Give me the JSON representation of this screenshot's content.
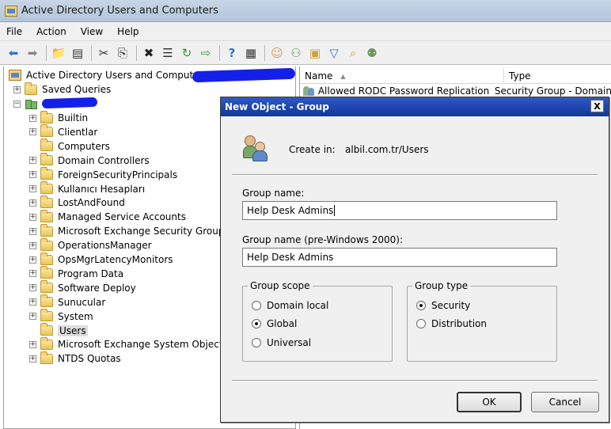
{
  "window": {
    "title": "Active Directory Users and Computers"
  },
  "menu": [
    "File",
    "Action",
    "View",
    "Help"
  ],
  "toolbar": {
    "icons": [
      "back-arrow-icon",
      "forward-arrow-icon",
      "up-folder-icon",
      "show-hide-console-tree-icon",
      "cut-icon",
      "copy-icon",
      "delete-icon",
      "properties-icon",
      "refresh-icon",
      "export-list-icon",
      "help-icon",
      "view-icon",
      "new-user-icon",
      "new-group-icon",
      "new-ou-icon",
      "filter-icon",
      "find-icon",
      "add-to-group-icon"
    ]
  },
  "tree": {
    "root": "Active Directory Users and Computers [",
    "saved_queries": "Saved Queries",
    "items": [
      {
        "label": "Builtin",
        "expandable": true
      },
      {
        "label": "Clientlar",
        "expandable": true
      },
      {
        "label": "Computers",
        "expandable": false
      },
      {
        "label": "Domain Controllers",
        "expandable": true
      },
      {
        "label": "ForeignSecurityPrincipals",
        "expandable": true
      },
      {
        "label": "Kullanıcı Hesapları",
        "expandable": true
      },
      {
        "label": "LostAndFound",
        "expandable": true
      },
      {
        "label": "Managed Service Accounts",
        "expandable": true
      },
      {
        "label": "Microsoft Exchange Security Groups",
        "expandable": true
      },
      {
        "label": "OperationsManager",
        "expandable": true
      },
      {
        "label": "OpsMgrLatencyMonitors",
        "expandable": true
      },
      {
        "label": "Program Data",
        "expandable": true
      },
      {
        "label": "Software Deploy",
        "expandable": true
      },
      {
        "label": "Sunucular",
        "expandable": true
      },
      {
        "label": "System",
        "expandable": true
      },
      {
        "label": "Users",
        "expandable": false,
        "selected": true
      },
      {
        "label": "Microsoft Exchange System Objects",
        "expandable": true
      },
      {
        "label": "NTDS Quotas",
        "expandable": true
      }
    ]
  },
  "list": {
    "columns": [
      "Name",
      "Type"
    ],
    "rows": [
      {
        "name": "Allowed RODC Password Replication Group",
        "type": "Security Group - Domain"
      }
    ]
  },
  "dialog": {
    "title": "New Object - Group",
    "close_label": "X",
    "create_in_label": "Create in:",
    "create_in_value": "albil.com.tr/Users",
    "group_name_label": "Group name:",
    "group_name_value": "Help Desk Admins",
    "group_name_pre2000_label": "Group name (pre-Windows 2000):",
    "group_name_pre2000_value": "Help Desk Admins",
    "group_scope": {
      "legend": "Group scope",
      "options": [
        "Domain local",
        "Global",
        "Universal"
      ],
      "selected": "Global"
    },
    "group_type": {
      "legend": "Group type",
      "options": [
        "Security",
        "Distribution"
      ],
      "selected": "Security"
    },
    "ok_label": "OK",
    "cancel_label": "Cancel"
  }
}
